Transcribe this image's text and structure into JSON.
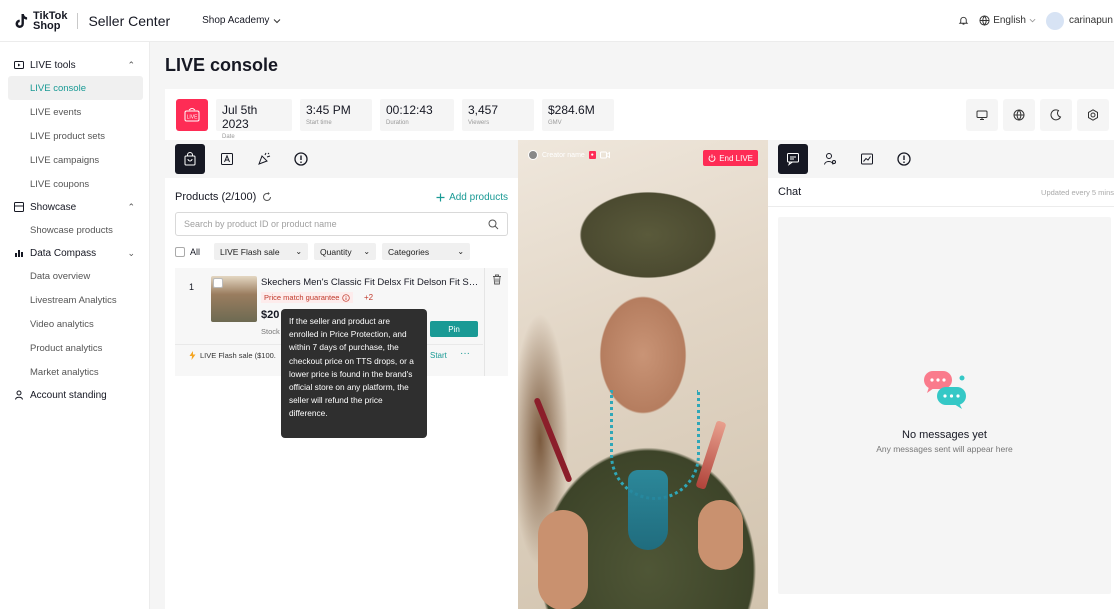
{
  "header": {
    "logo_text_1": "TikTok",
    "logo_text_2": "Shop",
    "seller_center": "Seller Center",
    "shop_academy": "Shop Academy",
    "language": "English",
    "username": "carinapun"
  },
  "sidebar": {
    "groups": [
      {
        "label": "LIVE tools",
        "items": [
          "LIVE console",
          "LIVE events",
          "LIVE product sets",
          "LIVE campaigns",
          "LIVE coupons"
        ]
      },
      {
        "label": "Showcase",
        "items": [
          "Showcase products"
        ]
      },
      {
        "label": "Data Compass",
        "items": [
          "Data overview",
          "Livestream Analytics",
          "Video analytics",
          "Product analytics",
          "Market analytics"
        ]
      },
      {
        "label": "Account standing",
        "items": []
      }
    ]
  },
  "page": {
    "title": "LIVE console"
  },
  "stats": {
    "live_badge": "LIVE",
    "date": {
      "value": "Jul 5th 2023",
      "label": "Date"
    },
    "start_time": {
      "value": "3:45 PM",
      "label": "Start time"
    },
    "duration": {
      "value": "00:12:43",
      "label": "Duration"
    },
    "viewers": {
      "value": "3,457",
      "label": "Viewers"
    },
    "gmv": {
      "value": "$284.6M",
      "label": "GMV"
    }
  },
  "products": {
    "title": "Products (2/100)",
    "add_label": "Add products",
    "search_placeholder": "Search by product ID or product name",
    "all_label": "All",
    "filters": [
      "LIVE Flash sale",
      "Quantity",
      "Categories"
    ],
    "item": {
      "index": "1",
      "title": "Skechers Men's Classic Fit Delsx Fit Delson Fit Sk...",
      "tag": "Price match guarantee",
      "tag_more": "+2",
      "price": "$20",
      "stock": "Stock",
      "pin": "Pin",
      "flash": "LIVE Flash sale ($100.",
      "start": "Start",
      "more": "···"
    },
    "tooltip": "If the seller and product are enrolled in Price Protection, and within 7 days of purchase, the checkout price on TTS drops, or a lower price is found in the brand's official store on any platform, the seller will refund the price difference."
  },
  "video": {
    "creator": "Creator name",
    "end_live": "End LIVE"
  },
  "chat": {
    "title": "Chat",
    "updated": "Updated every 5 mins",
    "empty_title": "No messages yet",
    "empty_sub": "Any messages sent will appear here"
  },
  "colors": {
    "accent": "#1a9a95",
    "live": "#fe2c55",
    "dark": "#161823"
  }
}
